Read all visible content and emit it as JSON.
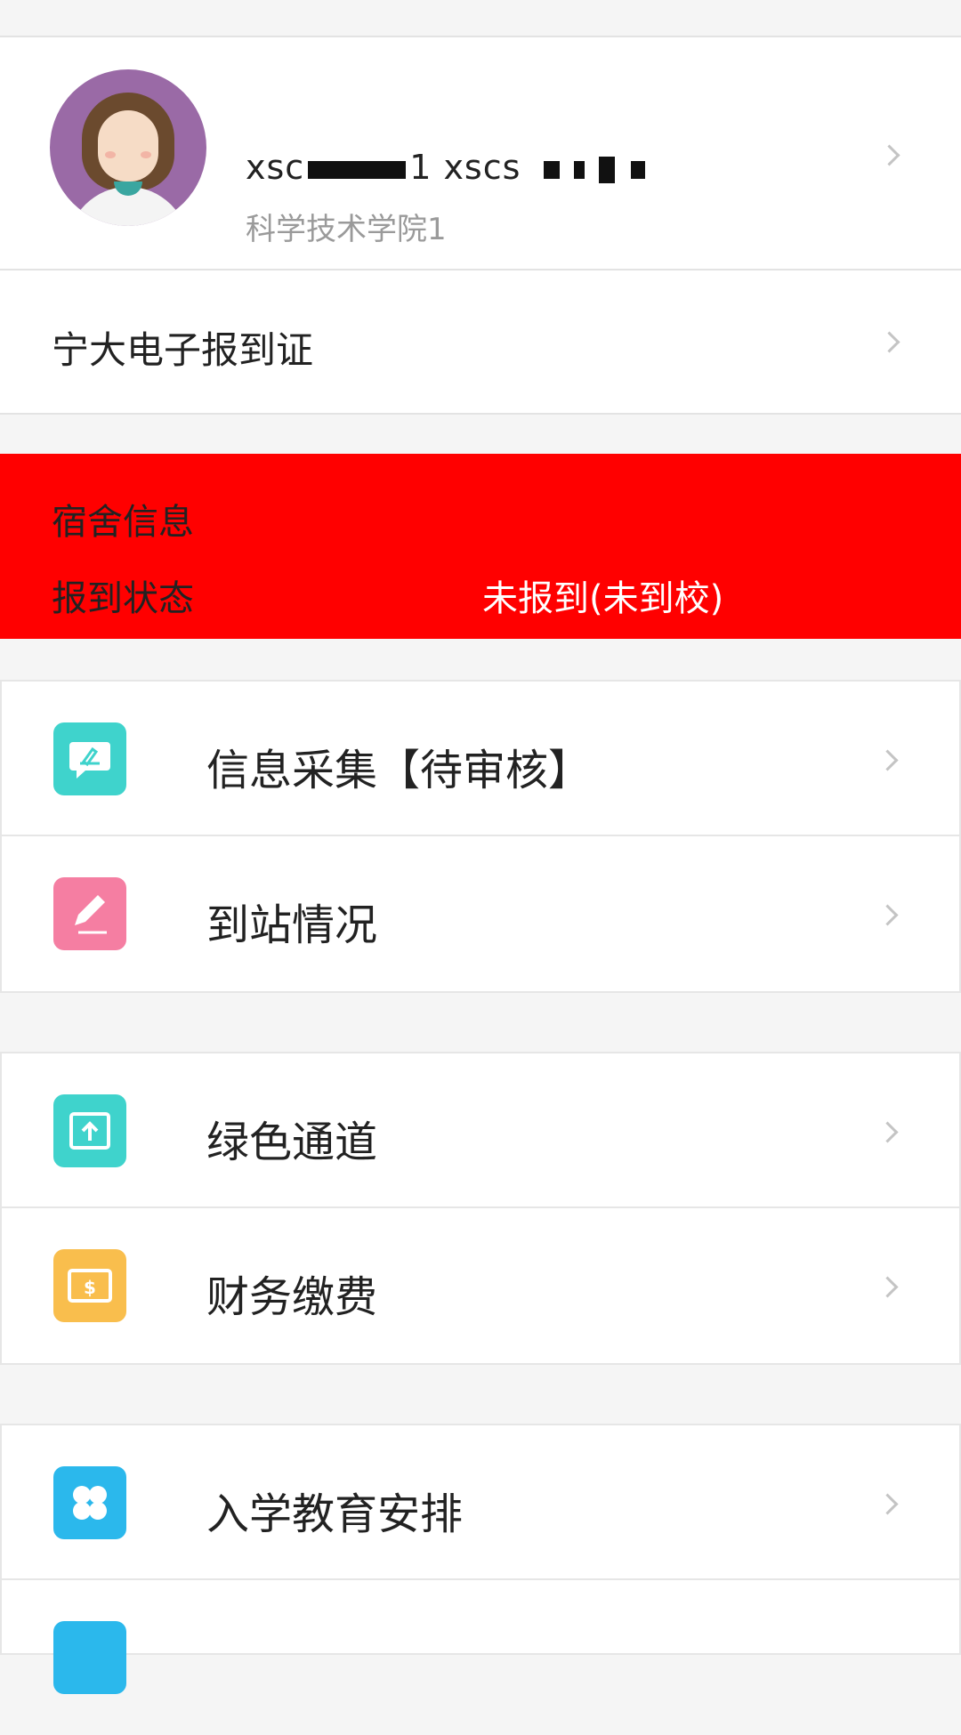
{
  "profile": {
    "name_prefix": "xsc",
    "name_middle": "1 xscs",
    "department": "科学技术学院1"
  },
  "e_registration": {
    "label": "宁大电子报到证"
  },
  "dorm": {
    "title": "宿舍信息",
    "status_label": "报到状态",
    "status_value": "未报到(未到校)"
  },
  "menu": [
    {
      "label": "信息采集【待审核】",
      "icon": "chat-edit-icon",
      "color": "#3fd3cc"
    },
    {
      "label": "到站情况",
      "icon": "pencil-icon",
      "color": "#f57ea2"
    },
    {
      "label": "绿色通道",
      "icon": "upload-icon",
      "color": "#3fd3cc"
    },
    {
      "label": "财务缴费",
      "icon": "dollar-icon",
      "color": "#f9be4d"
    },
    {
      "label": "入学教育安排",
      "icon": "grid-icon",
      "color": "#2bb8ec"
    }
  ],
  "colors": {
    "dorm_band": "#ff0000",
    "background": "#f5f5f5"
  }
}
